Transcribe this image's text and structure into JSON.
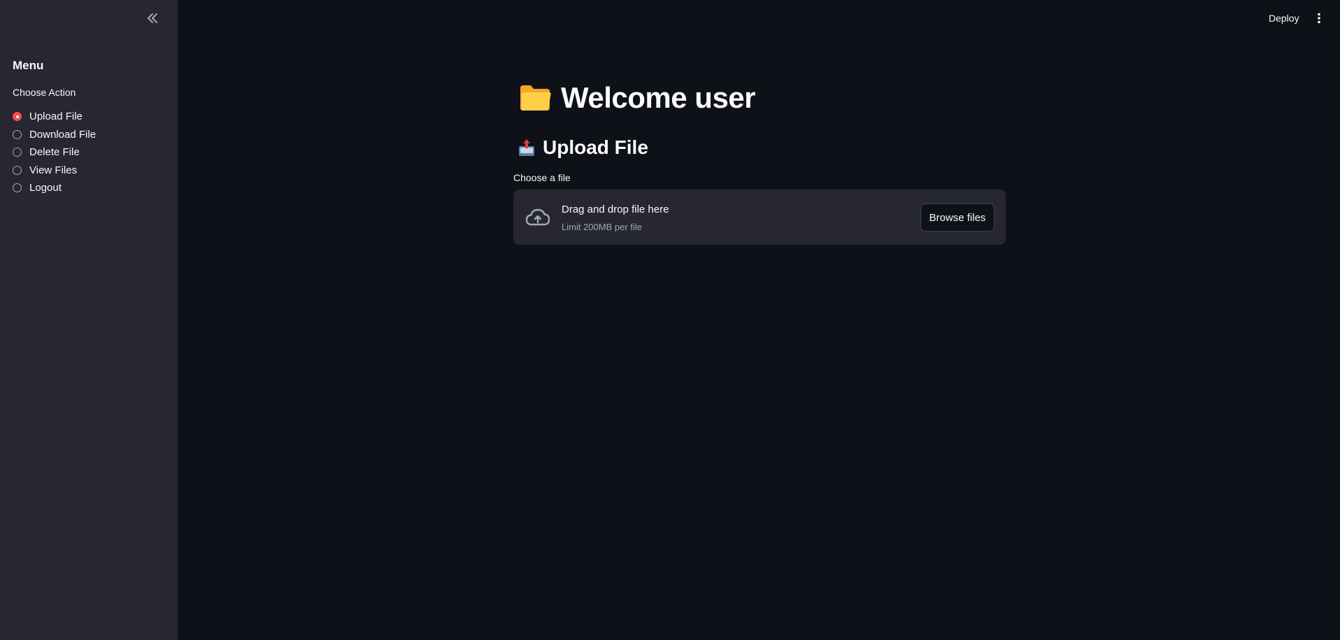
{
  "sidebar": {
    "collapse_icon": "double-chevron-left-icon",
    "title": "Menu",
    "radio_label": "Choose Action",
    "options": [
      {
        "label": "Upload File",
        "selected": true
      },
      {
        "label": "Download File",
        "selected": false
      },
      {
        "label": "Delete File",
        "selected": false
      },
      {
        "label": "View Files",
        "selected": false
      },
      {
        "label": "Logout",
        "selected": false
      }
    ],
    "accent_color": "#ff4b4b"
  },
  "header": {
    "deploy_label": "Deploy",
    "menu_icon": "vertical-dots-icon"
  },
  "main": {
    "title_icon": "folder-icon",
    "title": "Welcome user",
    "subtitle_icon": "outbox-tray-icon",
    "subtitle": "Upload File",
    "uploader": {
      "label": "Choose a file",
      "icon": "cloud-upload-icon",
      "drop_text": "Drag and drop file here",
      "limit_text": "Limit 200MB per file",
      "browse_label": "Browse files"
    }
  },
  "colors": {
    "background": "#0e1117",
    "sidebar_bg": "#262730",
    "text": "#fafafa",
    "muted_text": "#a3a8b8"
  }
}
